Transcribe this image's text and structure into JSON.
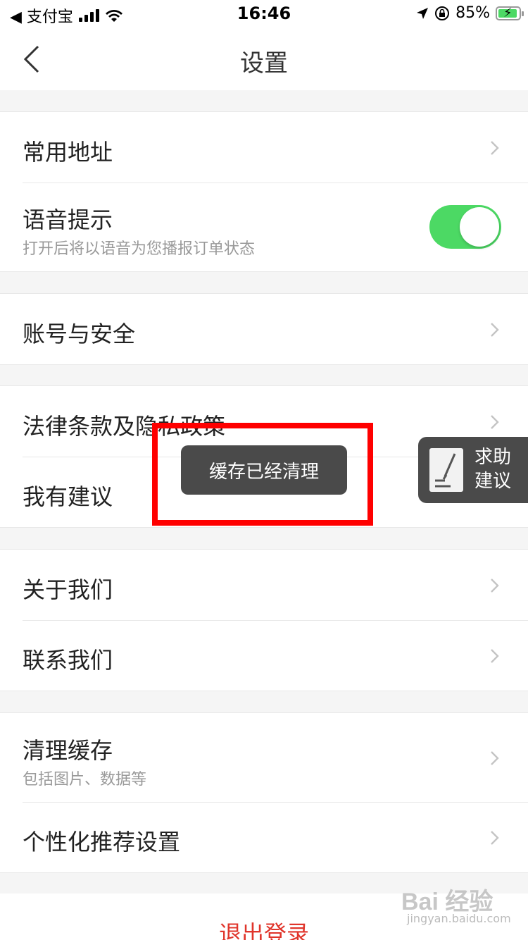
{
  "status_bar": {
    "back_app": "◀ 支付宝",
    "time": "16:46",
    "battery": "85%"
  },
  "nav": {
    "title": "设置"
  },
  "groups": {
    "g1": {
      "address": {
        "title": "常用地址"
      },
      "voice": {
        "title": "语音提示",
        "subtitle": "打开后将以语音为您播报订单状态",
        "toggle_on": true
      }
    },
    "g2": {
      "account": {
        "title": "账号与安全"
      }
    },
    "g3": {
      "legal": {
        "title": "法律条款及隐私政策"
      },
      "feedback": {
        "title": "我有建议"
      }
    },
    "g4": {
      "about": {
        "title": "关于我们"
      },
      "contact": {
        "title": "联系我们"
      }
    },
    "g5": {
      "clear_cache": {
        "title": "清理缓存",
        "subtitle": "包括图片、数据等"
      },
      "personalized": {
        "title": "个性化推荐设置"
      }
    }
  },
  "logout_label": "退出登录",
  "toast": {
    "message": "缓存已经清理"
  },
  "help_float": {
    "line1": "求助",
    "line2": "建议"
  },
  "watermark": {
    "logo": "Bai 经验",
    "url": "jingyan.baidu.com"
  },
  "colors": {
    "toggle_on": "#4cd964",
    "logout": "#e0352b",
    "highlight": "#ff0000"
  }
}
